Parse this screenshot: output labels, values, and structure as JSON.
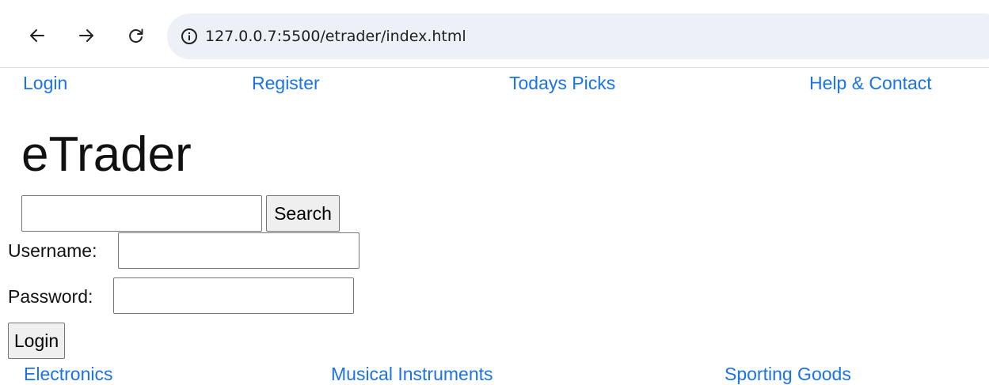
{
  "browser": {
    "back_icon": "arrow-left-icon",
    "forward_icon": "arrow-right-icon",
    "reload_icon": "reload-icon",
    "info_icon": "info-icon",
    "url": "127.0.0.7:5500/etrader/index.html"
  },
  "top_nav": [
    {
      "label": "Login"
    },
    {
      "label": "Register"
    },
    {
      "label": "Todays Picks"
    },
    {
      "label": "Help & Contact"
    }
  ],
  "site_title": "eTrader",
  "search": {
    "value": "",
    "placeholder": "",
    "button_label": "Search"
  },
  "login_form": {
    "username_label": "Username:",
    "username_value": "",
    "password_label": "Password:",
    "password_value": "",
    "submit_label": "Login"
  },
  "categories": [
    {
      "label": "Electronics"
    },
    {
      "label": "Musical Instruments"
    },
    {
      "label": "Sporting Goods"
    }
  ],
  "colors": {
    "link": "#1a73e8",
    "omnibox_bg": "#eef0f8",
    "button_bg": "#efefef"
  }
}
